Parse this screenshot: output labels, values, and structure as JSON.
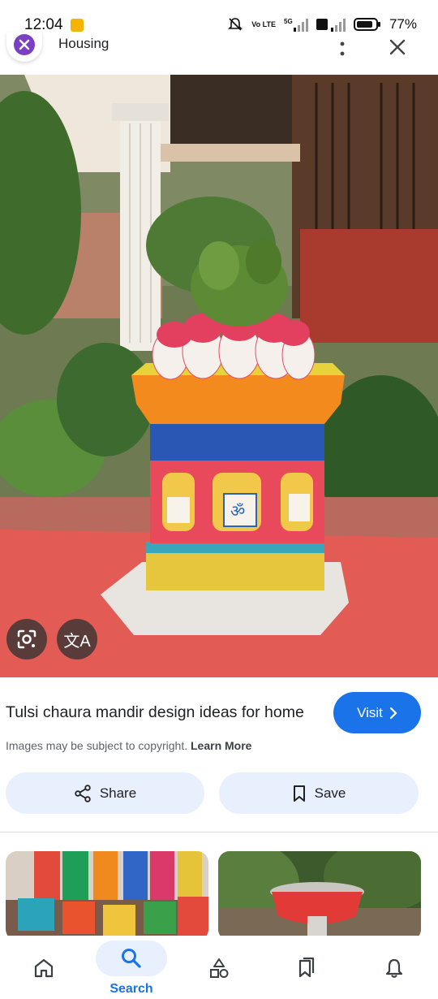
{
  "status_bar": {
    "time": "12:04",
    "battery": "77%",
    "network": "5G",
    "volte": "Vo LTE"
  },
  "header": {
    "site_name": "Housing",
    "logo_icon": "housing-logo-icon",
    "more_icon": "more-vert-icon",
    "close_icon": "close-icon"
  },
  "image_overlay": {
    "lens_icon": "google-lens-icon",
    "translate_icon": "translate-icon",
    "translate_glyph": "文A"
  },
  "result": {
    "title": "Tulsi chaura mandir design ideas for home",
    "visit_label": "Visit",
    "copyright_text": "Images may be subject to copyright.",
    "learn_more": "Learn More",
    "share_label": "Share",
    "save_label": "Save"
  },
  "bottom_nav": {
    "items": [
      {
        "name": "home",
        "icon": "home-icon",
        "label": ""
      },
      {
        "name": "search",
        "icon": "search-icon",
        "label": "Search"
      },
      {
        "name": "collections",
        "icon": "shapes-icon",
        "label": ""
      },
      {
        "name": "saved",
        "icon": "bookmarks-icon",
        "label": ""
      },
      {
        "name": "notifications",
        "icon": "bell-icon",
        "label": ""
      }
    ]
  },
  "colors": {
    "accent": "#1a73e8",
    "pill_bg": "#e8f0fe"
  }
}
